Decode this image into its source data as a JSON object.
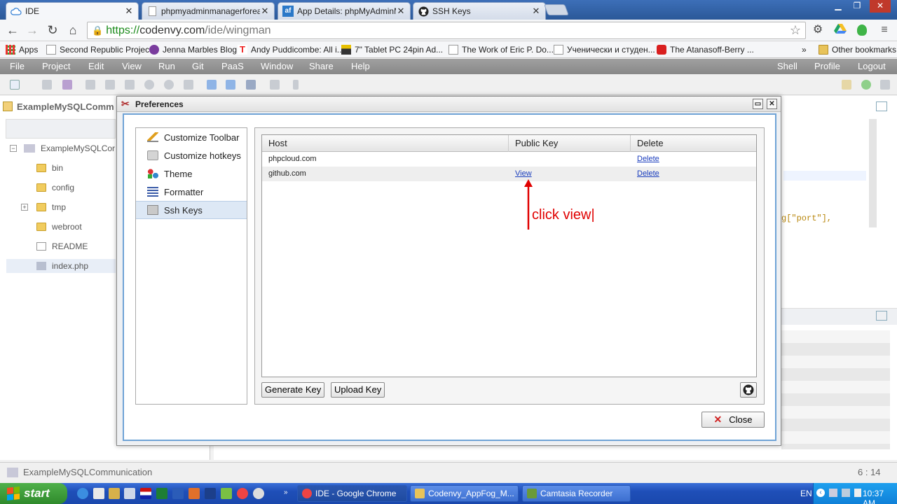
{
  "browser": {
    "tabs": [
      {
        "label": "IDE",
        "icon": "cloud-icon"
      },
      {
        "label": "phpmyadminmanagerforeast",
        "icon": "page-icon"
      },
      {
        "label": "App Details: phpMyAdminMar",
        "icon": "appfog-icon"
      },
      {
        "label": "SSH Keys",
        "icon": "github-icon"
      }
    ],
    "url_protocol": "https://",
    "url_host": "codenvy.com",
    "url_path": "/ide/wingman",
    "bookmarks": [
      {
        "label": "Apps"
      },
      {
        "label": "Second Republic Project"
      },
      {
        "label": "Jenna Marbles Blog"
      },
      {
        "label": "Andy Puddicombe: All i..."
      },
      {
        "label": "7\" Tablet PC 24pin Ad..."
      },
      {
        "label": "The Work of Eric P. Do..."
      },
      {
        "label": "Ученически и студен..."
      },
      {
        "label": "The Atanasoff-Berry ..."
      }
    ],
    "more_bookmarks": "»",
    "other_bookmarks": "Other bookmarks"
  },
  "ide": {
    "menu_left": [
      "File",
      "Project",
      "Edit",
      "View",
      "Run",
      "Git",
      "PaaS",
      "Window",
      "Share",
      "Help"
    ],
    "menu_right": [
      "Shell",
      "Profile",
      "Logout"
    ],
    "project_tab": "ExampleMySQLComm",
    "tree": [
      {
        "label": "ExampleMySQLCor",
        "type": "project"
      },
      {
        "label": "bin",
        "type": "folder"
      },
      {
        "label": "config",
        "type": "folder"
      },
      {
        "label": "tmp",
        "type": "folder"
      },
      {
        "label": "webroot",
        "type": "folder"
      },
      {
        "label": "README",
        "type": "file"
      },
      {
        "label": "index.php",
        "type": "php"
      }
    ],
    "code_fragment": "g[\"port\"],",
    "status_project": "ExampleMySQLCommunication",
    "status_cursor": "6 : 14"
  },
  "dialog": {
    "title": "Preferences",
    "sidebar": [
      {
        "label": "Customize Toolbar",
        "icon": "pencil-icon"
      },
      {
        "label": "Customize hotkeys",
        "icon": "keyboard-icon"
      },
      {
        "label": "Theme",
        "icon": "shapes-icon"
      },
      {
        "label": "Formatter",
        "icon": "align-icon"
      },
      {
        "label": "Ssh Keys",
        "icon": "key-icon",
        "selected": true
      }
    ],
    "table_headers": [
      "Host",
      "Public Key",
      "Delete"
    ],
    "rows": [
      {
        "host": "phpcloud.com",
        "public_key": "",
        "delete": "Delete"
      },
      {
        "host": "github.com",
        "public_key": "View",
        "delete": "Delete"
      }
    ],
    "generate_key": "Generate Key",
    "upload_key": "Upload Key",
    "close": "Close"
  },
  "annotation": {
    "text": "click view|",
    "color": "#e00000"
  },
  "taskbar": {
    "start": "start",
    "buttons": [
      {
        "label": "IDE - Google Chrome",
        "active": true
      },
      {
        "label": "Codenvy_AppFog_M...",
        "active": false
      },
      {
        "label": "Camtasia Recorder",
        "active": false
      }
    ],
    "language": "EN",
    "clock": "10:37 AM"
  }
}
